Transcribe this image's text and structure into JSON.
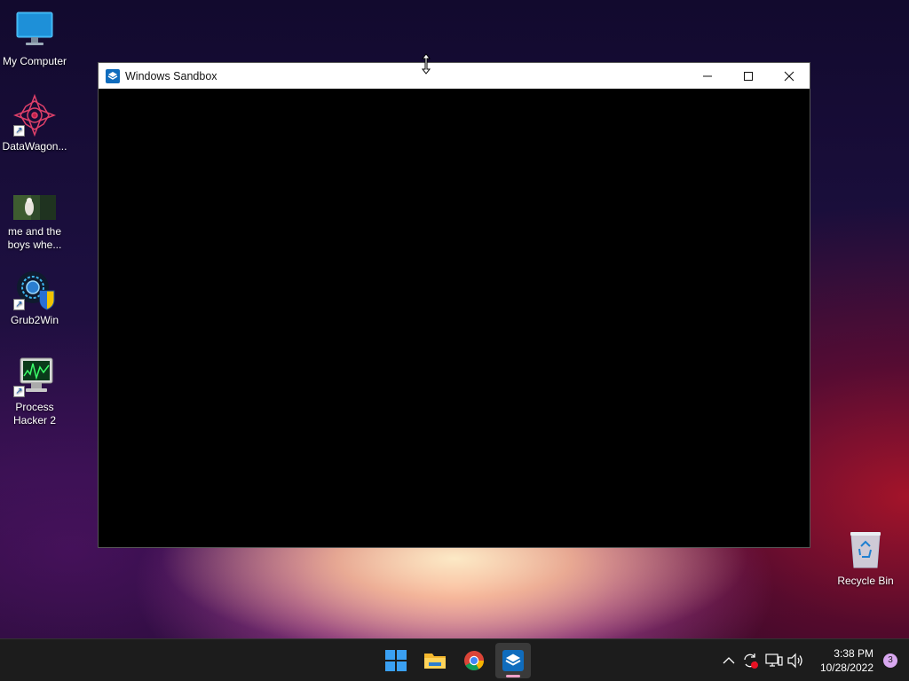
{
  "desktop": {
    "icons": [
      {
        "label": "My Computer",
        "icon": "monitor-icon"
      },
      {
        "label": "DataWagon...",
        "icon": "datawagon-logo-icon"
      },
      {
        "label": "me and the boys whe...",
        "icon": "image-thumbnail-icon"
      },
      {
        "label": "Grub2Win",
        "icon": "grub2win-icon"
      },
      {
        "label": "Process Hacker 2",
        "icon": "process-hacker-icon"
      },
      {
        "label": "Recycle Bin",
        "icon": "recycle-bin-icon"
      }
    ]
  },
  "window": {
    "title": "Windows Sandbox",
    "icon": "windows-sandbox-icon",
    "controls": [
      "minimize-icon",
      "maximize-icon",
      "close-icon"
    ]
  },
  "taskbar": {
    "apps": [
      {
        "name": "Start",
        "icon": "windows-start-icon"
      },
      {
        "name": "File Explorer",
        "icon": "folder-icon"
      },
      {
        "name": "Google Chrome",
        "icon": "chrome-icon"
      },
      {
        "name": "Windows Sandbox",
        "icon": "windows-sandbox-icon",
        "active": true
      }
    ],
    "tray": {
      "icons": [
        "chevron-up-icon",
        "sync-icon",
        "network-icon",
        "volume-icon"
      ],
      "time": "3:38 PM",
      "date": "10/28/2022",
      "notification_count": "3"
    }
  },
  "colors": {
    "accent": "#0078d4",
    "taskbar_bg": "#1c1c1c",
    "active_indicator": "#f0a0c8"
  }
}
